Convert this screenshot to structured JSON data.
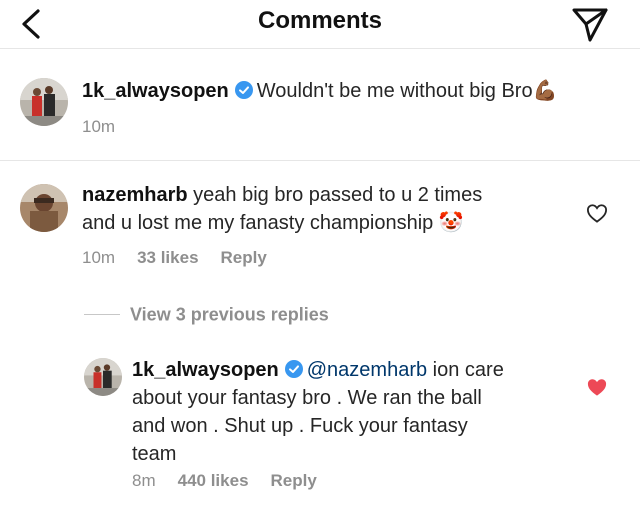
{
  "header": {
    "title": "Comments"
  },
  "caption": {
    "username": "1k_alwaysopen",
    "text": "Wouldn't be me without big Bro",
    "emoji": "💪🏾",
    "time": "10m"
  },
  "comment1": {
    "username": "nazemharb",
    "text_line1": "yeah big bro passed to u 2 times",
    "text_line2": "and u lost me my fanasty championship",
    "emoji": "🤡",
    "time": "10m",
    "likes": "33 likes",
    "reply": "Reply"
  },
  "view_replies": "View 3 previous replies",
  "reply1": {
    "username": "1k_alwaysopen",
    "mention": "@nazemharb",
    "text_line1": " ion care",
    "text_line2": "about your fantasy bro . We ran the ball",
    "text_line3": "and won . Shut up . Fuck your fantasy",
    "text_line4": "team",
    "time": "8m",
    "likes": "440 likes",
    "reply": "Reply"
  },
  "colors": {
    "verified": "#3897f0",
    "liked_heart": "#ed4956",
    "meta": "#8e8e8e",
    "mention": "#00376b"
  }
}
